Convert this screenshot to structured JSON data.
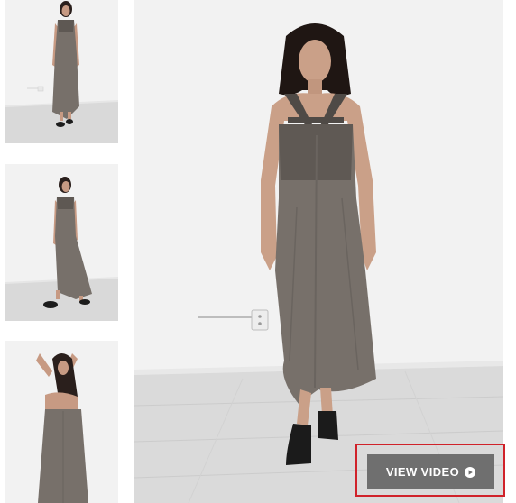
{
  "gallery": {
    "thumbnails": [
      {
        "alt": ""
      },
      {
        "alt": ""
      },
      {
        "alt": ""
      }
    ],
    "main_image": {
      "alt": ""
    },
    "video_button": {
      "label": "VIEW VIDEO",
      "icon": "play-circle-icon"
    }
  },
  "colors": {
    "button_bg": "#6f6f6f",
    "button_text": "#ffffff",
    "highlight_border": "#d0222a",
    "dress": "#77706a",
    "floor": "#d9d9d9",
    "wall": "#f2f2f2"
  }
}
